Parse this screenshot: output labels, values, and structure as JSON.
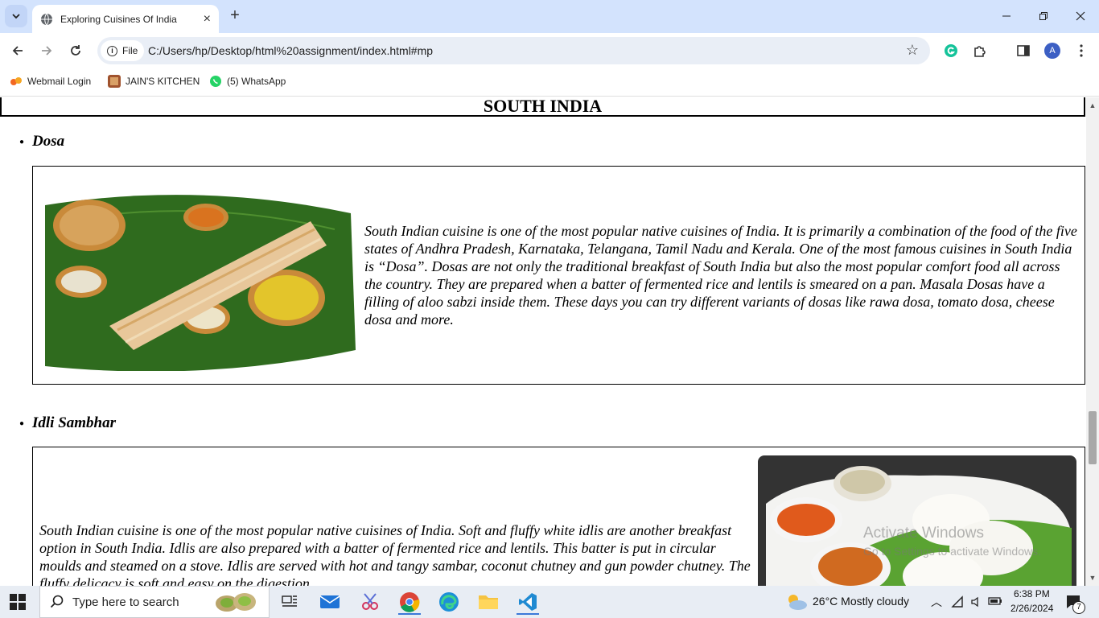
{
  "browser": {
    "tab_title": "Exploring Cuisines Of India",
    "close_tab": "×",
    "new_tab": "+",
    "site_info": "File",
    "url": "C:/Users/hp/Desktop/html%20assignment/index.html#mp",
    "profile_initial": "A"
  },
  "bookmarks": [
    {
      "label": "Webmail Login"
    },
    {
      "label": "JAIN'S KITCHEN"
    },
    {
      "label": "(5) WhatsApp"
    }
  ],
  "page": {
    "region_heading": "SOUTH INDIA",
    "dishes": [
      {
        "name": "Dosa",
        "description": "South Indian cuisine is one of the most popular native cuisines of India. It is primarily a combination of the food of the five states of Andhra Pradesh, Karnataka, Telangana, Tamil Nadu and Kerala. One of the most famous cuisines in South India is “Dosa”. Dosas are not only the traditional breakfast of South India but also the most popular comfort food all across the country. They are prepared when a batter of fermented rice and lentils is smeared on a pan. Masala Dosas have a filling of aloo sabzi inside them. These days you can try different variants of dosas like rawa dosa, tomato dosa, cheese dosa and more."
      },
      {
        "name": "Idli Sambhar",
        "description": "South Indian cuisine is one of the most popular native cuisines of India. Soft and fluffy white idlis are another breakfast option in South India. Idlis are also prepared with a batter of fermented rice and lentils. This batter is put in circular moulds and steamed on a stove. Idlis are served with hot and tangy sambar, coconut chutney and gun powder chutney. The fluffy delicacy is soft and easy on the digestion."
      }
    ]
  },
  "watermark": {
    "line1": "Activate Windows",
    "line2": "Go to Settings to activate Windows."
  },
  "taskbar": {
    "search_placeholder": "Type here to search",
    "weather": "26°C  Mostly cloudy",
    "time": "6:38 PM",
    "date": "2/26/2024",
    "notification_count": "7"
  },
  "colors": {
    "tabstrip": "#d3e3fd",
    "omnibox": "#e9eef6",
    "taskbar": "#e8edf4"
  }
}
